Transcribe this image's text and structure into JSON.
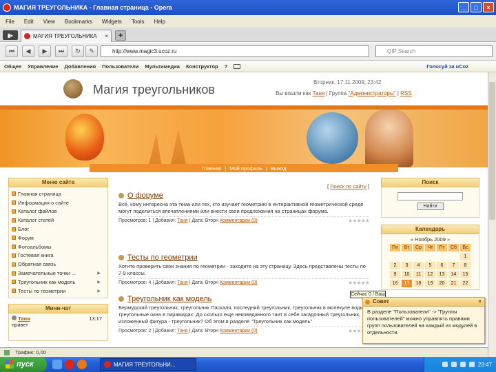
{
  "window": {
    "title": "МАГИЯ ТРЕУГОЛЬНИКА - Главная страница - Opera",
    "controls": [
      "minimize-icon",
      "maximize-icon",
      "close-icon"
    ]
  },
  "menu": [
    "File",
    "Edit",
    "View",
    "Bookmarks",
    "Widgets",
    "Tools",
    "Help"
  ],
  "tabs": [
    {
      "label": "МАГИЯ ТРЕУГОЛЬНИКА"
    }
  ],
  "tab_new_label": "+",
  "address_bar": {
    "value": "http://www.magic3.ucoz.ru"
  },
  "search_bar": {
    "placeholder": "QIP Search"
  },
  "ucoz_bar": {
    "items": [
      "Общее",
      "Управление",
      "Добавления",
      "Пользователи",
      "Мультимедиа",
      "Конструктор",
      "?"
    ],
    "right_link": "Голосуй за uCoz"
  },
  "site": {
    "title": "Магия треугольников",
    "date": "Вторник, 17.11.2009, 23:42",
    "greeting_prefix": "Вы вошли как",
    "user": "Таня",
    "group_prefix": "| Группа",
    "group": "\"Администраторы\"",
    "rss": "RSS",
    "nav": [
      "Главная",
      "Мой профиль",
      "Выход"
    ]
  },
  "left_menu": {
    "title": "Меню сайта",
    "items": [
      {
        "label": "Главная страница",
        "arrow": false
      },
      {
        "label": "Информация о сайте",
        "arrow": false
      },
      {
        "label": "Каталог файлов",
        "arrow": false
      },
      {
        "label": "Каталог статей",
        "arrow": false
      },
      {
        "label": "Блог",
        "arrow": false
      },
      {
        "label": "Форум",
        "arrow": false
      },
      {
        "label": "Фотоальбомы",
        "arrow": false
      },
      {
        "label": "Гостевая книга",
        "arrow": false
      },
      {
        "label": "Обратная связь",
        "arrow": false
      },
      {
        "label": "Замечательные точки ...",
        "arrow": true
      },
      {
        "label": "Треугольник как модель",
        "arrow": true
      },
      {
        "label": "Тесты по геометрии",
        "arrow": true
      }
    ]
  },
  "mini_chat": {
    "title": "Мини-чат",
    "author": "Таня",
    "time": "13:17",
    "text": "привет"
  },
  "main": {
    "search_link_prefix": "[",
    "search_link": "Поиск по сайту",
    "search_link_suffix": "]",
    "posts": [
      {
        "title": "О форуме",
        "text": "Всё, кому интересна эта тема или тех, кто изучает геометрию в интерактивной геометрической среде могут поделиться впечатлениями или внести свои предложения на страницах форума.",
        "link": "",
        "meta_views": "Просмотров: 1",
        "meta_added": "| Добавил:",
        "meta_author": "Таня",
        "meta_date": "| Дата: Вторн",
        "meta_comments": "Комментарии (0)"
      },
      {
        "title": "Тесты по геометрии",
        "text": "Хотите проверить свои знания по геометрии - заходите на эту страницу. Здесь представлены тесты по 7-9 классы.",
        "link": "эту",
        "meta_views": "Просмотров: 4",
        "meta_added": "| Добавил:",
        "meta_author": "Таня",
        "meta_date": "| Дата: Вторн",
        "meta_comments": "Комментарии (0)"
      },
      {
        "title": "Треугольник как модель",
        "text": "Бермудский треугольник, треугольник Паскаля, последний треугольник, треугольник в молекуле воды, треугольные окна в пирамидах. До сколько еще неизведанного таит в себе загадочный треугольник, изложенный фигура - треугольник? Об этом в разделе \"Треугольник как модель\"",
        "link": "",
        "meta_views": "Просмотров: 2",
        "meta_added": "| Добавил:",
        "meta_author": "Таня",
        "meta_date": "| Дата: Вторн",
        "meta_comments": "Комментарии (0)"
      }
    ]
  },
  "right": {
    "search_title": "Поиск",
    "search_button": "Найти",
    "calendar_title": "Календарь",
    "calendar_month": "« Ноябрь 2009 »",
    "weekdays": [
      "Пн",
      "Вт",
      "Ср",
      "Чт",
      "Пт",
      "Сб",
      "Вс"
    ],
    "days": [
      "",
      "",
      "",
      "",
      "",
      "",
      "1",
      "2",
      "3",
      "4",
      "5",
      "6",
      "7",
      "8",
      "9",
      "10",
      "11",
      "12",
      "13",
      "14",
      "15",
      "16",
      "17",
      "18",
      "19",
      "20",
      "21",
      "22"
    ],
    "today": "17"
  },
  "tooltip": "Сейчас 0 / Ваш",
  "notification": {
    "title": "Совет",
    "text": "В разделе \"Пользователи\" -> \"Группы пользователей\" можно управлять правами групп пользователей на каждый из модулей в отдельности.",
    "close": "×"
  },
  "status": {
    "text": "Трафик: 0,00"
  },
  "taskbar": {
    "start_label": "пуск",
    "task_label": "МАГИЯ ТРЕУГОЛЬНИ...",
    "clock": "23:47"
  }
}
